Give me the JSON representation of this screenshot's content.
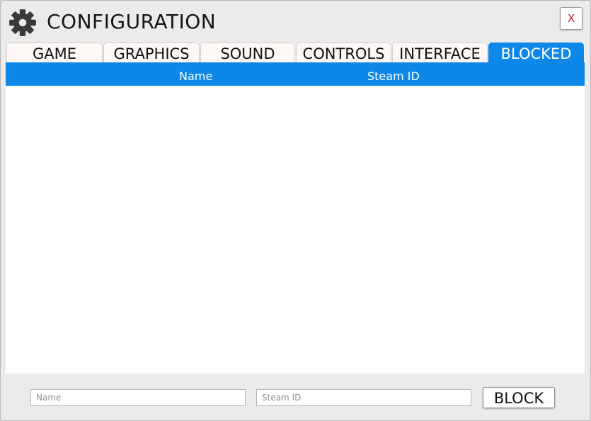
{
  "window": {
    "title": "CONFIGURATION",
    "icon": "gear-icon",
    "close_label": "X"
  },
  "tabs": [
    {
      "label": "GAME",
      "active": false
    },
    {
      "label": "GRAPHICS",
      "active": false
    },
    {
      "label": "SOUND",
      "active": false
    },
    {
      "label": "CONTROLS",
      "active": false
    },
    {
      "label": "INTERFACE",
      "active": false
    },
    {
      "label": "BLOCKED",
      "active": true
    }
  ],
  "table": {
    "columns": [
      "Name",
      "Steam ID"
    ],
    "rows": []
  },
  "form": {
    "name_placeholder": "Name",
    "steam_placeholder": "Steam ID",
    "block_label": "BLOCK"
  },
  "colors": {
    "accent": "#0d87e8",
    "close": "#cc1a1a",
    "background": "#ebebeb"
  }
}
